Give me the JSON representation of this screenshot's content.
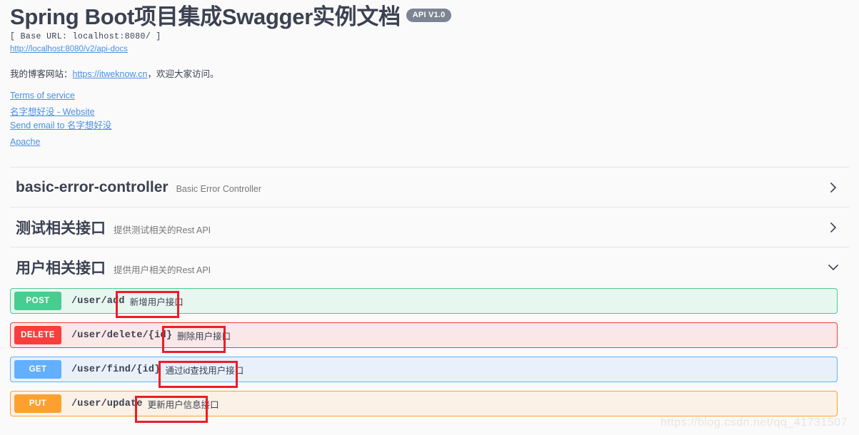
{
  "header": {
    "title": "Spring Boot项目集成Swagger实例文档",
    "version_badge": "API V1.0",
    "base_url": "[ Base URL: localhost:8080/ ]",
    "api_docs_link": "http://localhost:8080/v2/api-docs",
    "description_prefix": "我的博客网站：",
    "description_link": "https://itweknow.cn",
    "description_suffix": "，欢迎大家访问。"
  },
  "meta_links": {
    "terms_of_service": "Terms of service",
    "contact_website": "名字想好没 - Website",
    "contact_email": "Send email to 名字想好没",
    "license": "Apache"
  },
  "sections": [
    {
      "name": "basic-error-controller",
      "description": "Basic Error Controller",
      "expanded": false,
      "chevron": "chevron-right-icon",
      "operations": []
    },
    {
      "name": "测试相关接口",
      "description": "提供测试相关的Rest API",
      "expanded": false,
      "chevron": "chevron-right-icon",
      "operations": []
    },
    {
      "name": "用户相关接口",
      "description": "提供用户相关的Rest API",
      "expanded": true,
      "chevron": "chevron-down-icon",
      "operations": [
        {
          "method": "POST",
          "path": "/user/add",
          "summary": "新增用户接口",
          "annotated": true
        },
        {
          "method": "DELETE",
          "path": "/user/delete/{id}",
          "summary": "删除用户接口",
          "annotated": true
        },
        {
          "method": "GET",
          "path": "/user/find/{id}",
          "summary": "通过id查找用户接口",
          "annotated": true
        },
        {
          "method": "PUT",
          "path": "/user/update",
          "summary": "更新用户信息接口",
          "annotated": true
        }
      ]
    }
  ],
  "watermark": "https://blog.csdn.net/qq_41731507",
  "colors": {
    "post": "#49cc90",
    "delete": "#f93e3e",
    "get": "#61affe",
    "put": "#fca130",
    "link": "#4990e2",
    "text": "#3b4151",
    "badge": "#7d8492",
    "annotation": "#ee1c25"
  }
}
